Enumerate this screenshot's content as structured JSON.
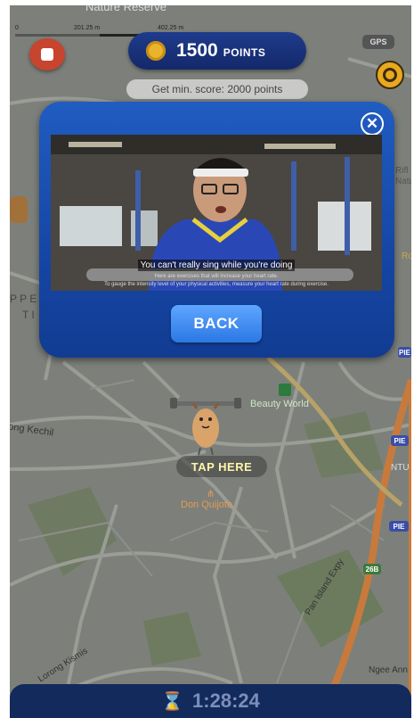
{
  "hud": {
    "scale_left": "0",
    "scale_mid": "201.25 m",
    "scale_right": "402.25 m",
    "points_value": "1500",
    "points_unit": "POINTS",
    "min_score": "Get min. score: 2000 points",
    "gps_label": "GPS",
    "timer": "1:28:24"
  },
  "map": {
    "labels": {
      "nature_top": "Nature Reserve",
      "rifle_1": "Rifl",
      "rifle_2": "Natu",
      "ro": "Ro",
      "ppe": "P P E",
      "ti": "T I",
      "beauty_world": "Beauty World",
      "kechil": "ong Kechil",
      "don_quijote": "Don Quijote",
      "ntu": "NTU",
      "pan_island": "Pan Island Expy",
      "lorong_kismis": "Lorong Kismis",
      "ngee_ann": "Ngee Ann",
      "pie_1": "PIE",
      "pie_2": "PIE",
      "road_26b": "26B",
      "pie_3": "PIE"
    }
  },
  "dialog": {
    "subtitle": "You can't really sing while you're doing",
    "caption_line1": "Here are exercises that will increase your heart rate.",
    "caption_line2": "To gauge the intensity level of your physical activities, measure your heart rate during exercise.",
    "back_label": "BACK",
    "close_symbol": "✕"
  },
  "character": {
    "tap_label": "TAP HERE"
  },
  "colors": {
    "dialog_blue": "#1a4fb0",
    "button_blue": "#3c8bf0",
    "points_pill": "#1b3784",
    "timer_bar": "#132a5c",
    "tap_text": "#fff4a8"
  },
  "icons": {
    "stop": "stop-icon",
    "coin": "coin-icon",
    "locate": "locate-icon",
    "close": "close-icon",
    "hourglass": "hourglass-icon"
  }
}
